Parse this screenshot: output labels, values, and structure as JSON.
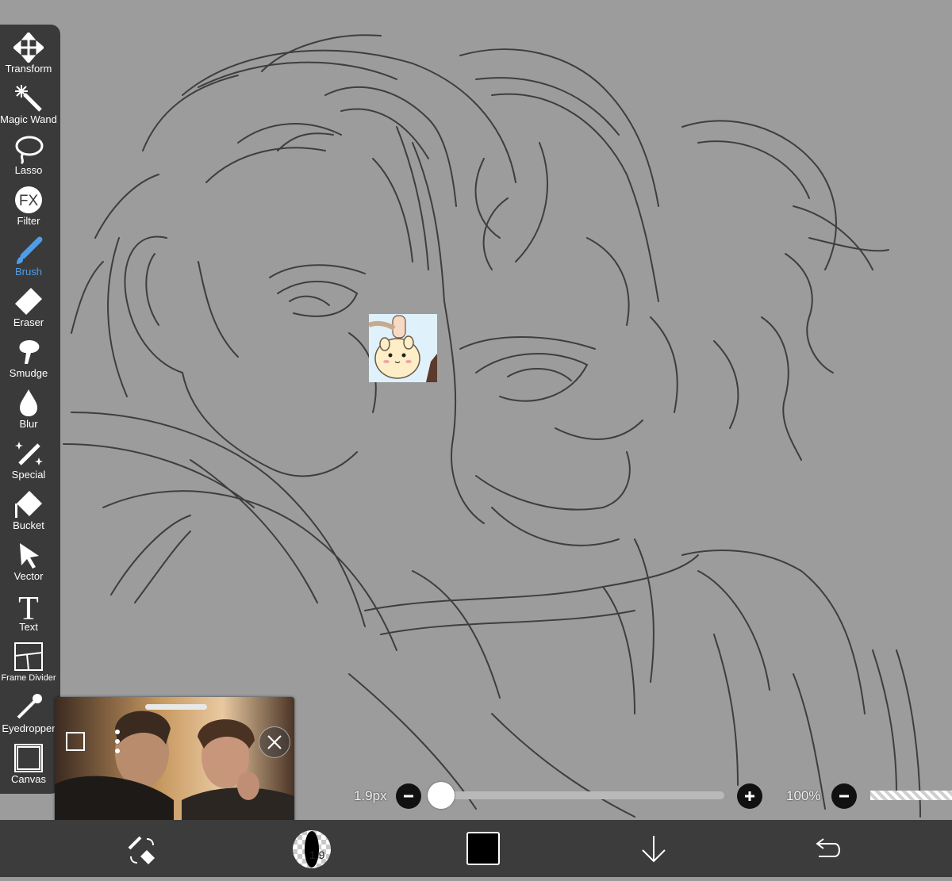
{
  "toolbar": {
    "tools": [
      {
        "label": "Transform",
        "icon": "move-arrows-icon"
      },
      {
        "label": "Magic Wand",
        "icon": "magic-wand-icon"
      },
      {
        "label": "Lasso",
        "icon": "lasso-icon"
      },
      {
        "label": "Filter",
        "icon": "fx-icon"
      },
      {
        "label": "Brush",
        "icon": "brush-icon"
      },
      {
        "label": "Eraser",
        "icon": "eraser-icon"
      },
      {
        "label": "Smudge",
        "icon": "smudge-icon"
      },
      {
        "label": "Blur",
        "icon": "blur-drop-icon"
      },
      {
        "label": "Special",
        "icon": "special-pen-icon"
      },
      {
        "label": "Bucket",
        "icon": "bucket-icon"
      },
      {
        "label": "Vector",
        "icon": "vector-cursor-icon"
      },
      {
        "label": "Text",
        "icon": "text-t-icon"
      },
      {
        "label": "Frame Divider",
        "icon": "frame-divider-icon"
      },
      {
        "label": "Eyedropper",
        "icon": "eyedropper-icon"
      },
      {
        "label": "Canvas",
        "icon": "canvas-icon"
      }
    ],
    "active_tool": "Brush",
    "active_color": "#4f9de8"
  },
  "filter_icon_text": "FX",
  "text_icon_glyph": "T",
  "brush_size": {
    "label": "1.9px",
    "value": 1.9,
    "fraction": 0.0
  },
  "opacity": {
    "label": "100%",
    "value": 100
  },
  "bottom_bar": {
    "brush_preview_number": "1.9",
    "current_color": "#000000",
    "icons": [
      "brush-eraser-swap-icon",
      "brush-preview-icon",
      "color-swatch-icon",
      "download-arrow-icon",
      "undo-icon"
    ]
  },
  "colors": {
    "canvas": "#9c9c9c",
    "toolbar": "#3a3a3a",
    "bottom_bar": "#3c3c3c",
    "stroke": "#2a2a2a"
  }
}
